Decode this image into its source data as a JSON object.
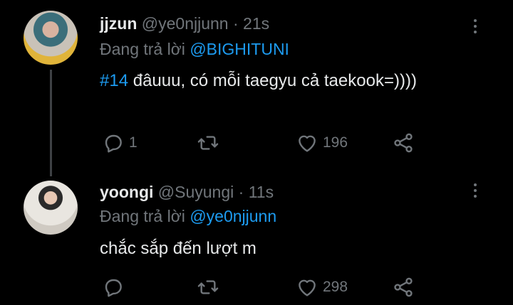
{
  "tweets": [
    {
      "name": "jjzun",
      "handle": "@ye0njjunn",
      "time": "· 21s",
      "reply_prefix": "Đang trả lời",
      "reply_to": "@BIGHITUNI",
      "hashtag": "#14",
      "text": " đâuuu, có mỗi taegyu cả taekook=))))",
      "replies": "1",
      "retweets": "",
      "likes": "196"
    },
    {
      "name": "yoongi",
      "handle": "@Suyungi",
      "time": "· 11s",
      "reply_prefix": "Đang trả lời",
      "reply_to": "@ye0njjunn",
      "text": "chắc sắp đến lượt m",
      "replies": "",
      "retweets": "",
      "likes": "298"
    }
  ],
  "colors": {
    "background": "#000000",
    "accent": "#1d9bf0",
    "muted": "#71767b",
    "text": "#e7e9ea"
  },
  "icons": [
    "reply-icon",
    "retweet-icon",
    "like-icon",
    "share-icon",
    "more-icon"
  ]
}
